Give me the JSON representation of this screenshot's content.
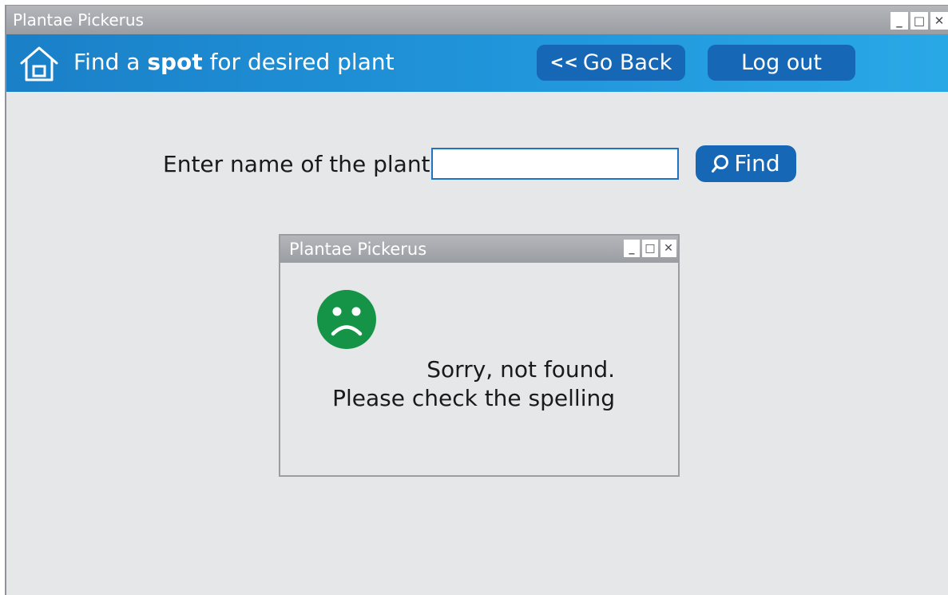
{
  "window": {
    "title": "Plantae Pickerus",
    "controls": {
      "minimize": "_",
      "maximize": "□",
      "close": "✕"
    }
  },
  "appbar": {
    "title_prefix": "Find a ",
    "title_bold": "spot",
    "title_suffix": " for desired plant",
    "go_back_chevron": "<<",
    "go_back_label": "Go Back",
    "logout_label": "Log out",
    "home_icon": "home-icon"
  },
  "search": {
    "label": "Enter name of the plant:",
    "value": "",
    "placeholder": "",
    "find_label": "Find",
    "find_icon": "magnifier-icon"
  },
  "dialog": {
    "title": "Plantae Pickerus",
    "controls": {
      "minimize": "_",
      "maximize": "□",
      "close": "✕"
    },
    "icon": "sad-face-icon",
    "icon_color": "#159447",
    "message_line1": "Sorry, not found.",
    "message_line2": "Please check the spelling"
  },
  "colors": {
    "accent": "#1667b6",
    "appbar": "#2196db",
    "titlebar": "#a5a8ac",
    "background": "#e6e7e9"
  }
}
